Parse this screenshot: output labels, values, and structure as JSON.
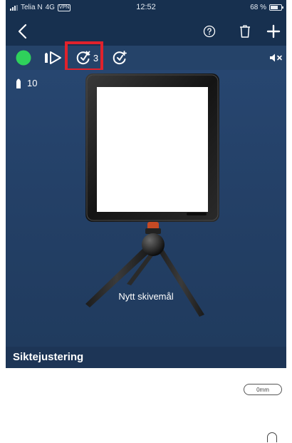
{
  "status_bar": {
    "carrier": "Telia N",
    "network": "4G",
    "vpn": "VPN",
    "time": "12:52",
    "battery_percent": "68 %",
    "battery_level": 0.68
  },
  "nav": {
    "back_icon": "chevron-left-icon",
    "help_icon": "question-circle-icon",
    "delete_icon": "trash-icon",
    "add_icon": "plus-icon"
  },
  "toolbar": {
    "status_color": "#2fd15b",
    "shot_count": "3",
    "mute_icon": "speaker-muted-icon"
  },
  "canvas": {
    "ammo_count": "10",
    "target_label": "Nytt skivemål"
  },
  "section": {
    "title": "Siktejustering"
  },
  "adjustment": {
    "value": "0mm"
  },
  "colors": {
    "highlight": "#e0222c",
    "nav_bg": "#17304f",
    "toolbar_bg": "#254369"
  }
}
